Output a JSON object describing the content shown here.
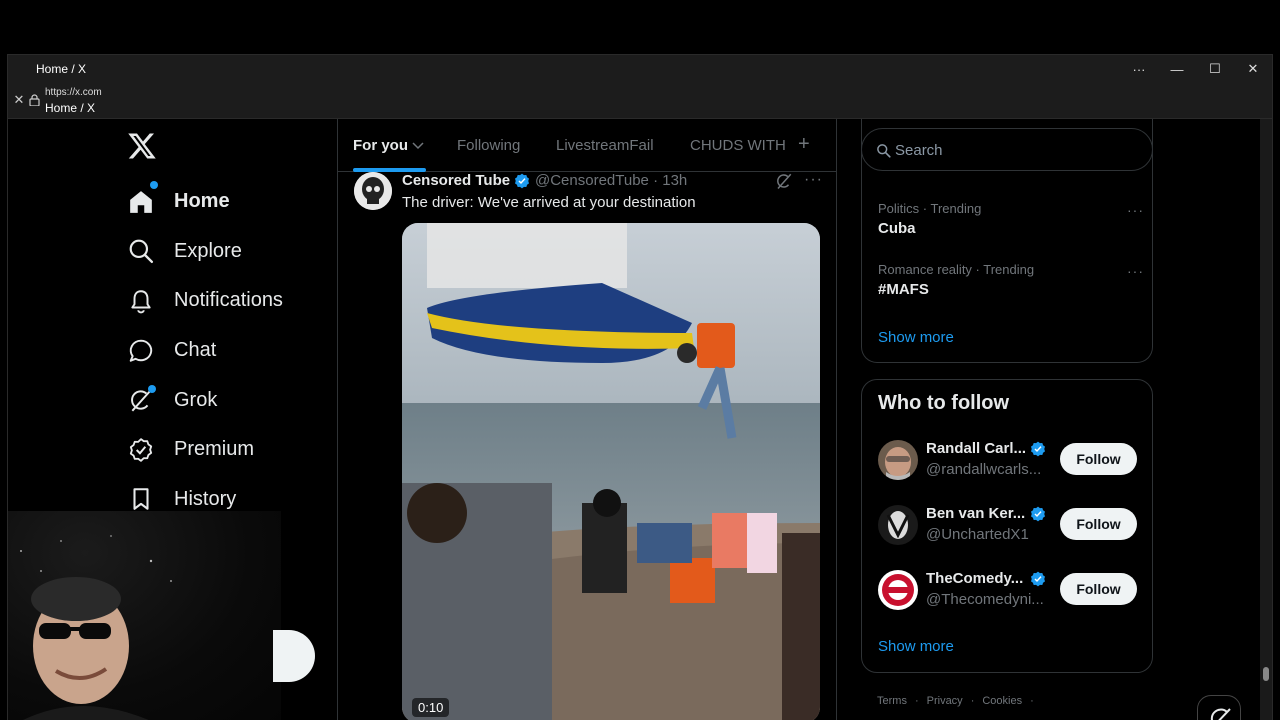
{
  "window": {
    "title": "Home / X",
    "url": "https://x.com",
    "page_title": "Home / X"
  },
  "nav": {
    "items": [
      {
        "label": "Home",
        "icon": "home-icon",
        "active": true,
        "dot": true
      },
      {
        "label": "Explore",
        "icon": "search-icon"
      },
      {
        "label": "Notifications",
        "icon": "bell-icon"
      },
      {
        "label": "Chat",
        "icon": "chat-bubble-icon"
      },
      {
        "label": "Grok",
        "icon": "grok-icon",
        "dot": true
      },
      {
        "label": "Premium",
        "icon": "verified-badge-icon"
      },
      {
        "label": "History",
        "icon": "bookmark-icon"
      }
    ]
  },
  "tabs": [
    {
      "label": "For you",
      "active": true
    },
    {
      "label": "Following"
    },
    {
      "label": "LivestreamFail"
    },
    {
      "label": "CHUDS WITH"
    }
  ],
  "tweet": {
    "name": "Censored Tube",
    "handle": "@CensoredTube",
    "time": "13h",
    "text": "The driver: We've arrived at your destination",
    "video_time": "0:10"
  },
  "search": {
    "placeholder": "Search"
  },
  "trends": {
    "items": [
      {
        "meta": "Politics · Trending",
        "name": "Cuba"
      },
      {
        "meta": "Romance reality · Trending",
        "name": "#MAFS"
      }
    ],
    "show_more": "Show more"
  },
  "who_to_follow": {
    "title": "Who to follow",
    "users": [
      {
        "name": "Randall Carl...",
        "handle": "@randallwcarls...",
        "button": "Follow"
      },
      {
        "name": "Ben van Ker...",
        "handle": "@UnchartedX1",
        "button": "Follow"
      },
      {
        "name": "TheComedy...",
        "handle": "@Thecomedyni...",
        "button": "Follow"
      }
    ],
    "show_more": "Show more"
  },
  "footer": {
    "links": [
      "Terms",
      "·",
      "Privacy",
      "·",
      "Cookies",
      "·"
    ]
  },
  "colors": {
    "accent": "#1d9bf0",
    "background": "#000000",
    "text": "#e7e9ea",
    "muted": "#71767b",
    "border": "#2f3336"
  }
}
